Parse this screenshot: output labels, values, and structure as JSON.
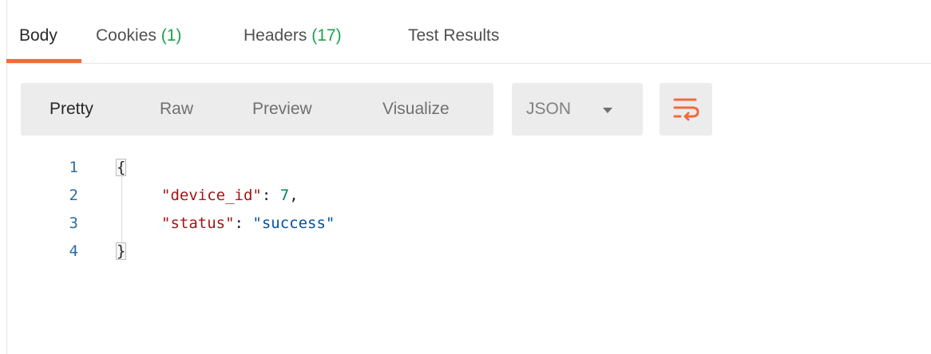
{
  "tabs": [
    {
      "label": "Body",
      "count": "",
      "active": true
    },
    {
      "label": "Cookies",
      "count": "(1)",
      "active": false
    },
    {
      "label": "Headers",
      "count": "(17)",
      "active": false
    },
    {
      "label": "Test Results",
      "count": "",
      "active": false
    }
  ],
  "toolbar": {
    "formats": [
      "Pretty",
      "Raw",
      "Preview",
      "Visualize"
    ],
    "active_format": "Pretty",
    "language": "JSON",
    "wrap_icon": "wrap-lines-icon"
  },
  "code": {
    "line_numbers": [
      "1",
      "2",
      "3",
      "4"
    ],
    "open_brace": "{",
    "close_brace": "}",
    "entries": [
      {
        "key": "\"device_id\"",
        "value": "7",
        "value_type": "number",
        "trailing": ","
      },
      {
        "key": "\"status\"",
        "value": "\"success\"",
        "value_type": "string",
        "trailing": ""
      }
    ]
  },
  "colors": {
    "accent": "#f26b3a",
    "count_green": "#1aa34a",
    "line_number": "#2d6da0",
    "json_key": "#a31515",
    "json_number": "#098658",
    "json_string": "#0451a5"
  }
}
